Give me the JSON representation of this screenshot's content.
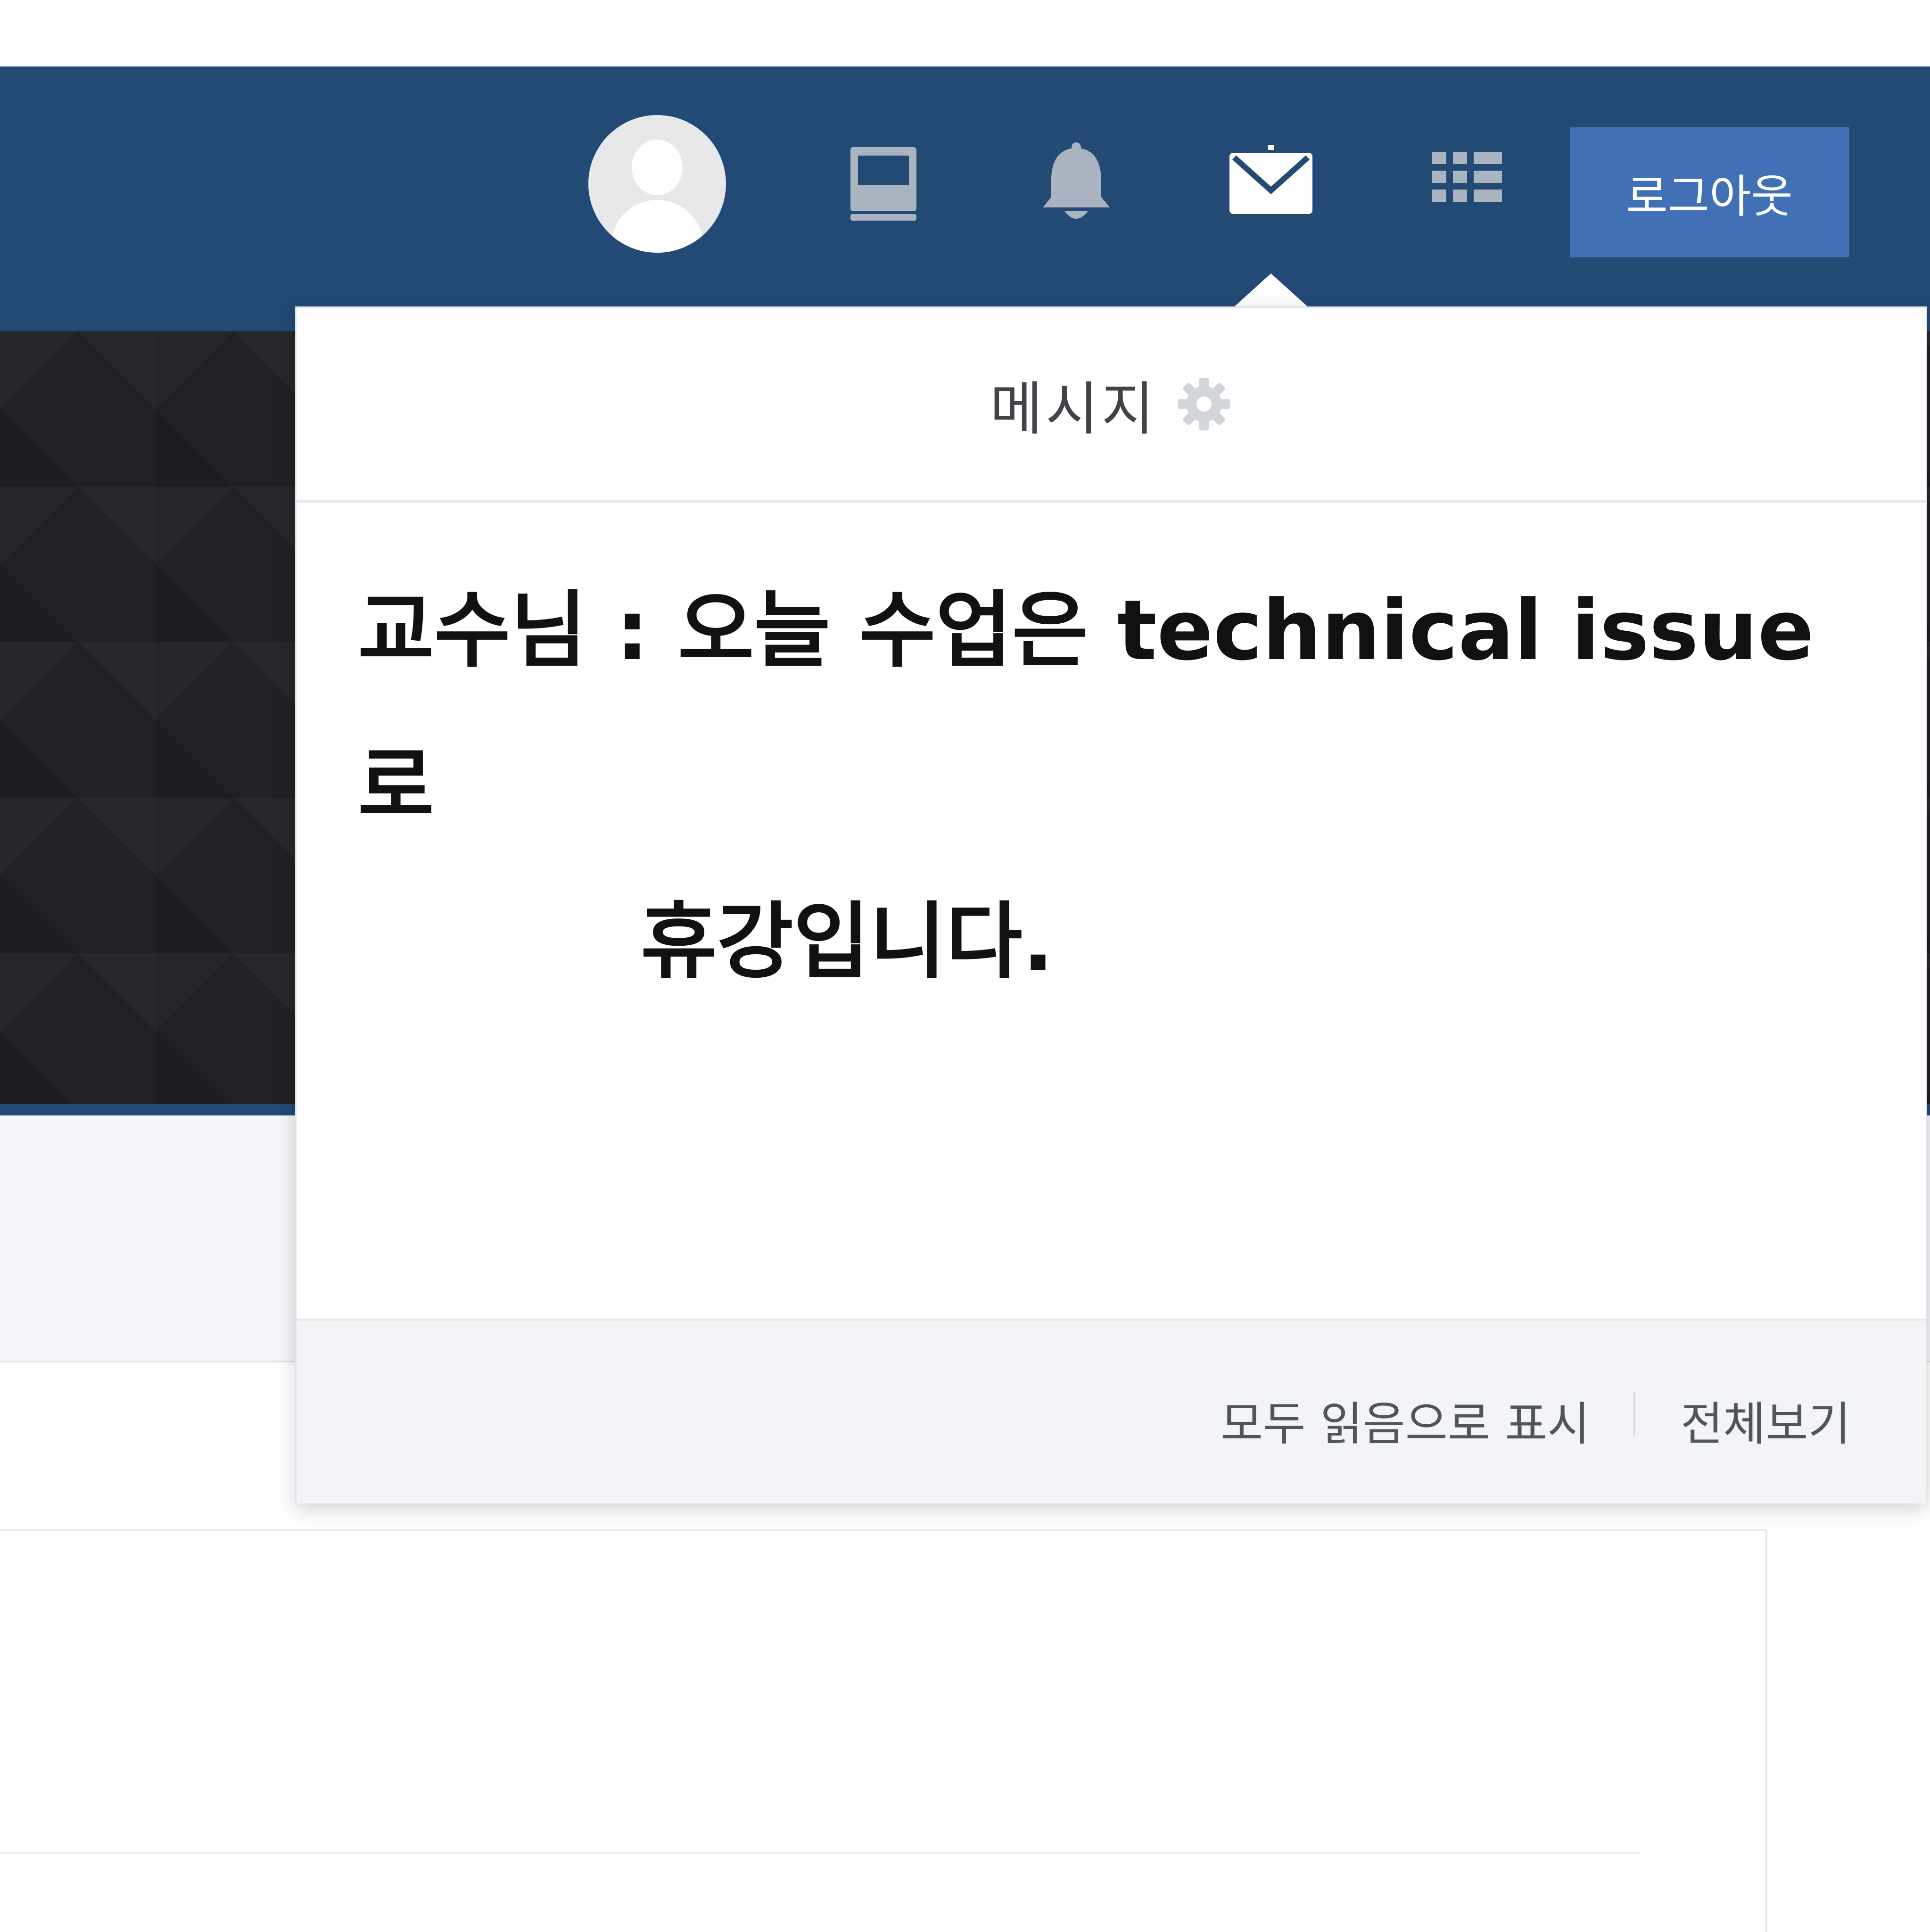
{
  "navbar": {
    "background_color": "#224a75",
    "icons": [
      "avatar",
      "book-icon",
      "bell-icon",
      "mail-icon",
      "grid-icon"
    ],
    "logout_label": "로그아웃",
    "logout_color": "#4170b7"
  },
  "dropdown": {
    "title": "메시지",
    "settings_icon": "gear-icon",
    "message": {
      "line1": "교수님 : 오늘 수업은 technical issue로",
      "line2": "휴강입니다."
    },
    "footer": {
      "mark_all_read": "모두 읽음으로 표시",
      "view_all": "전체보기"
    }
  }
}
